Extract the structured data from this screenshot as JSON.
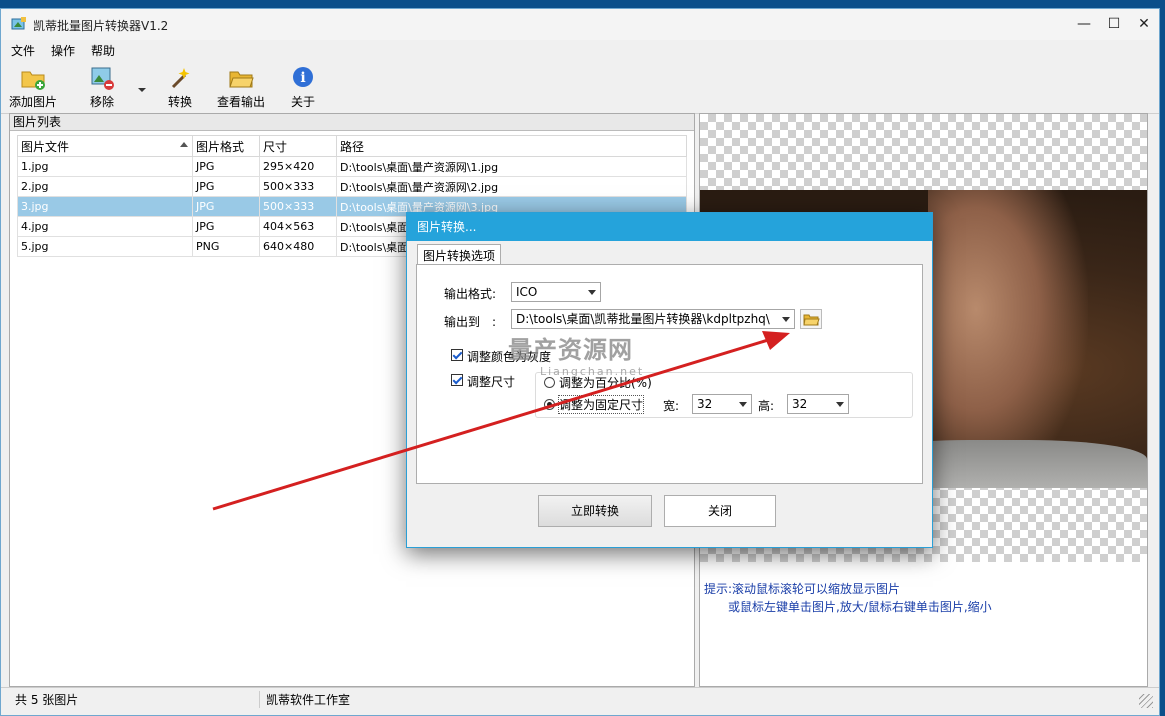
{
  "window": {
    "title": "凯蒂批量图片转换器V1.2",
    "min": "—",
    "max": "☐",
    "close": "✕"
  },
  "menu": [
    "文件",
    "操作",
    "帮助"
  ],
  "toolbar": {
    "add": "添加图片",
    "remove": "移除",
    "convert": "转换",
    "view_output": "查看输出",
    "about": "关于"
  },
  "list": {
    "header": "图片列表",
    "columns": [
      "图片文件",
      "图片格式",
      "尺寸",
      "路径"
    ],
    "rows": [
      [
        "1.jpg",
        "JPG",
        "295×420",
        "D:\\tools\\桌面\\量产资源网\\1.jpg"
      ],
      [
        "2.jpg",
        "JPG",
        "500×333",
        "D:\\tools\\桌面\\量产资源网\\2.jpg"
      ],
      [
        "3.jpg",
        "JPG",
        "500×333",
        "D:\\tools\\桌面\\量产资源网\\3.jpg"
      ],
      [
        "4.jpg",
        "JPG",
        "404×563",
        "D:\\tools\\桌面\\量"
      ],
      [
        "5.jpg",
        "PNG",
        "640×480",
        "D:\\tools\\桌面\\量"
      ]
    ],
    "selected_index": 2
  },
  "preview": {
    "hint_line1": "提示:滚动鼠标滚轮可以缩放显示图片",
    "hint_line2": "或鼠标左键单击图片,放大/鼠标右键单击图片,缩小"
  },
  "status": {
    "count": "共 5 张图片",
    "studio": "凯蒂软件工作室"
  },
  "dialog": {
    "title": "图片转换...",
    "tab": "图片转换选项",
    "format_label": "输出格式:",
    "format_value": "ICO",
    "output_label": "输出到　:",
    "output_value": "D:\\tools\\桌面\\凯蒂批量图片转换器\\kdpltpzhq\\",
    "grayscale_label": "调整颜色为灰度",
    "resize_label": "调整尺寸",
    "percent_label": "调整为百分比(%)",
    "fixed_label": "调整为固定尺寸",
    "width_label": "宽:",
    "width_value": "32",
    "height_label": "高:",
    "height_value": "32",
    "convert_btn": "立即转换",
    "close_btn": "关闭"
  },
  "watermark": {
    "text": "量产资源网",
    "sub": "Liangchan.net"
  }
}
